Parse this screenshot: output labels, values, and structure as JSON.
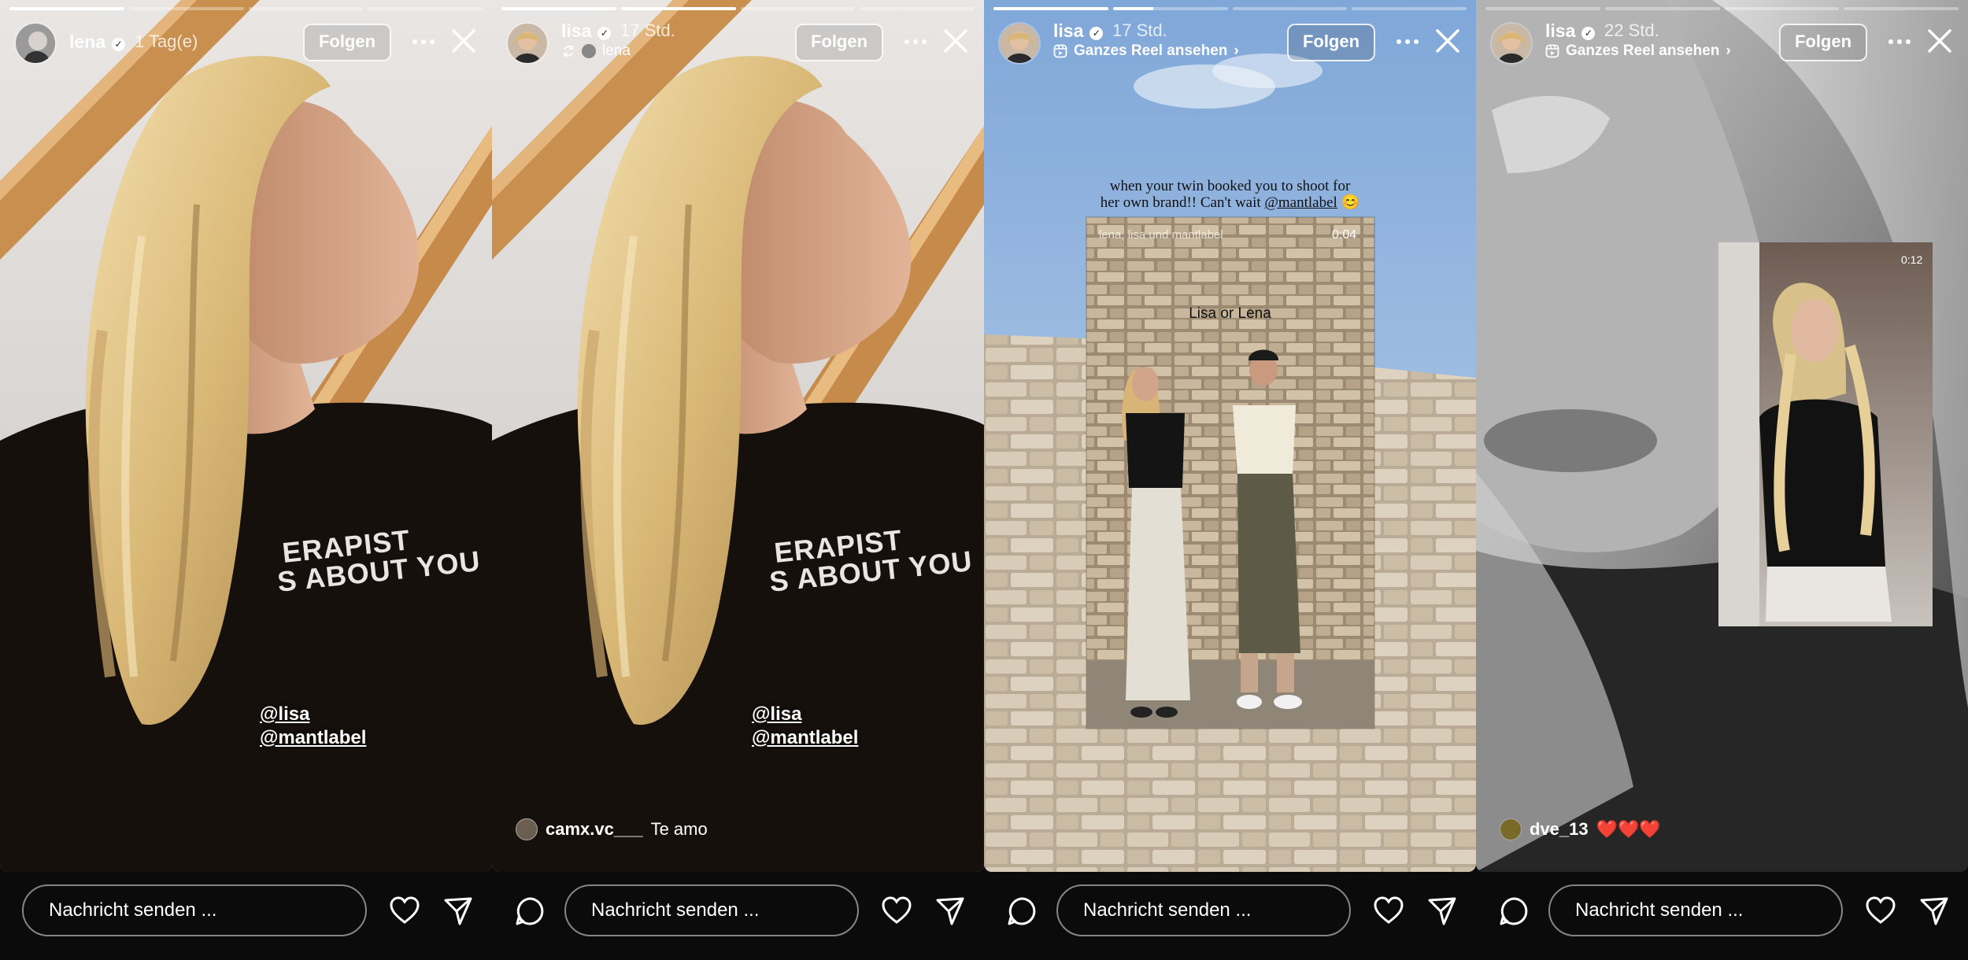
{
  "colors": {
    "background": "#0b0b0c",
    "accent": "#ffffff",
    "heart": "#e0242f"
  },
  "stories": [
    {
      "username": "lena",
      "time": "1 Tag(e)",
      "follow_label": "Folgen",
      "shirt_text_1": "ERAPIST",
      "shirt_text_2": "S ABOUT YOU",
      "mentions": [
        "@lisa",
        "@mantlabel"
      ],
      "progress": [
        1.0,
        0.0,
        0.0,
        0.0
      ],
      "message_placeholder": "Nachricht senden ..."
    },
    {
      "username": "lisa",
      "time": "17 Std.",
      "reshared_from": "lena",
      "follow_label": "Folgen",
      "shirt_text_1": "ERAPIST",
      "shirt_text_2": "S ABOUT YOU",
      "mentions": [
        "@lisa",
        "@mantlabel"
      ],
      "comment_user": "camx.vc___",
      "comment_text": "Te amo",
      "progress": [
        1.0,
        1.0,
        0.0,
        0.0
      ],
      "message_placeholder": "Nachricht senden ..."
    },
    {
      "username": "lisa",
      "time": "17 Std.",
      "reel_link": "Ganzes Reel ansehen",
      "follow_label": "Folgen",
      "caption_1": "when your twin booked you to shoot for",
      "caption_2": "her own brand!! Can't wait",
      "caption_mention": "@mantlabel",
      "reel_header": "lena, lisa und mantlabel",
      "reel_duration": "0:04",
      "reel_overlay": "Lisa or Lena",
      "progress": [
        1.0,
        0.35,
        0.0,
        0.0
      ],
      "message_placeholder": "Nachricht senden ..."
    },
    {
      "username": "lisa",
      "time": "22 Std.",
      "reel_link": "Ganzes Reel ansehen",
      "follow_label": "Folgen",
      "reel_duration": "0:12",
      "comment_user": "dve_13",
      "comment_text": "❤️❤️❤️",
      "progress": [
        0.0,
        0.0,
        0.0,
        0.0
      ],
      "message_placeholder": "Nachricht senden ..."
    }
  ],
  "icons": [
    "comment-icon",
    "heart-icon",
    "send-icon",
    "more-icon",
    "close-icon",
    "verified-icon",
    "reshare-icon",
    "reel-icon",
    "chevron-right-icon"
  ]
}
